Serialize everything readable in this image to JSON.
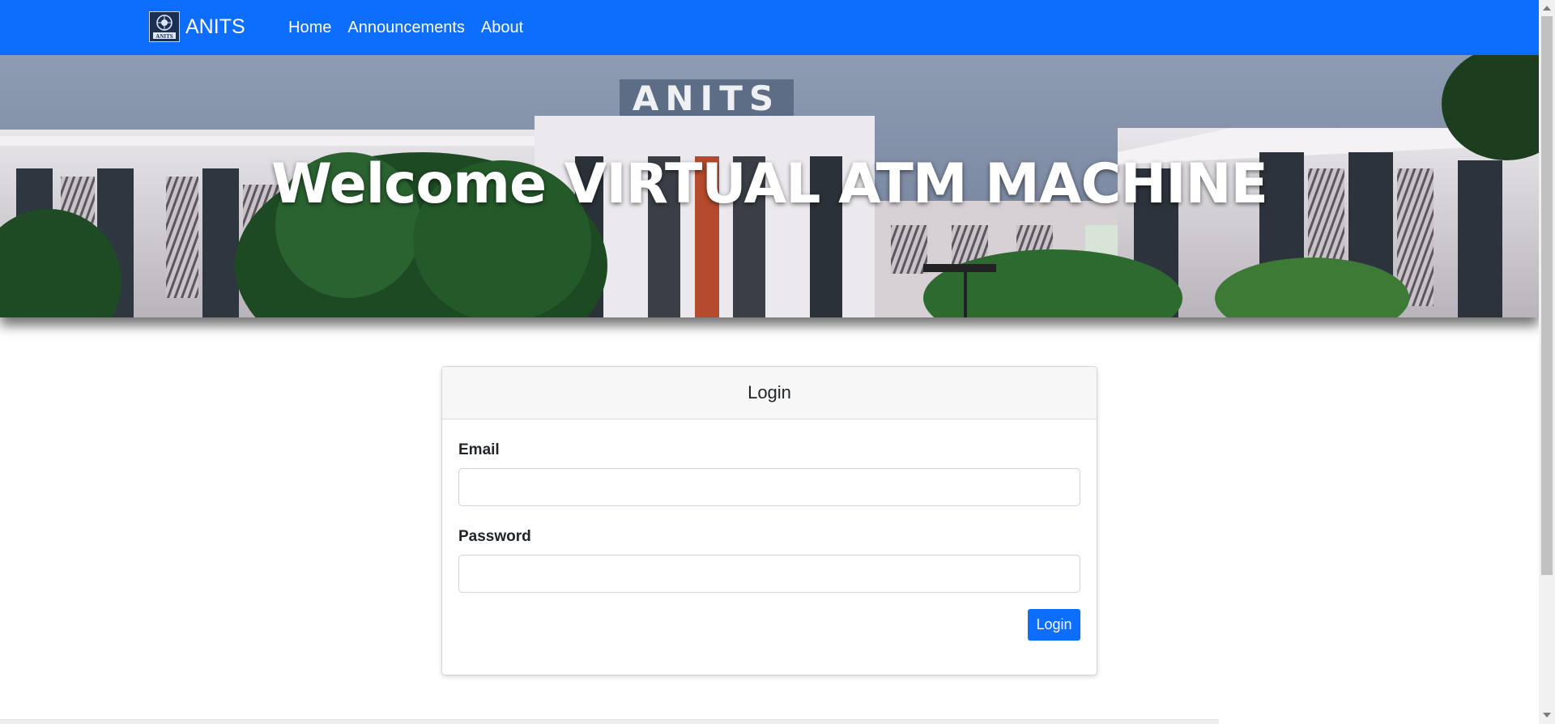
{
  "navbar": {
    "brand": "ANITS",
    "logo_text": "ANITS",
    "links": [
      {
        "label": "Home"
      },
      {
        "label": "Announcements"
      },
      {
        "label": "About"
      }
    ],
    "color": "#0d6efd"
  },
  "hero": {
    "title": "Welcome VIRTUAL ATM MACHINE",
    "building_sign": "ANITS"
  },
  "login_card": {
    "title": "Login",
    "email_label": "Email",
    "email_value": "",
    "password_label": "Password",
    "password_value": "",
    "submit_label": "Login"
  }
}
